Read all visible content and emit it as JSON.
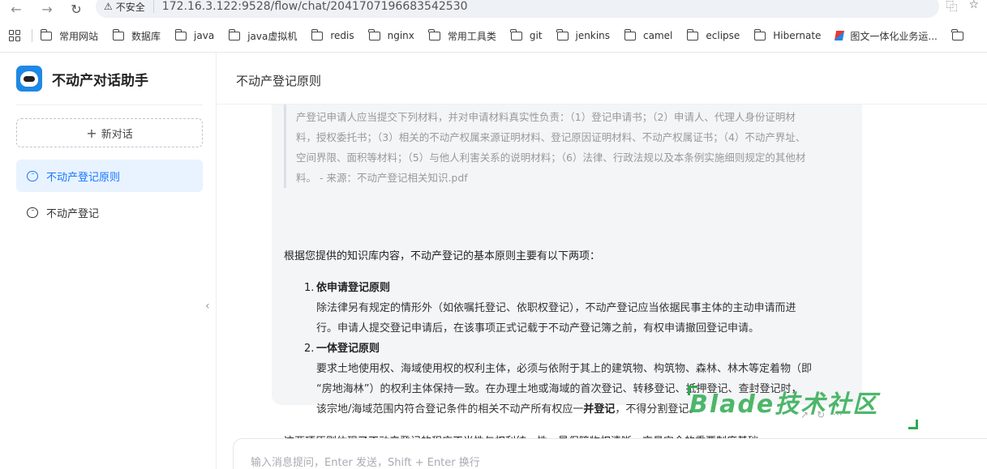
{
  "browser": {
    "insecure_label": "不安全",
    "url": "172.16.3.122:9528/flow/chat/2041707196683542530",
    "bookmarks": [
      "常用网站",
      "数据库",
      "java",
      "java虚拟机",
      "redis",
      "nginx",
      "常用工具类",
      "git",
      "jenkins",
      "camel",
      "eclipse",
      "Hibernate",
      "图文一体化业务运..."
    ]
  },
  "app": {
    "name": "不动产对话助手",
    "new_chat_label": "新对话",
    "conversations": [
      {
        "label": "不动产登记原则",
        "active": true
      },
      {
        "label": "不动产登记",
        "active": false
      }
    ]
  },
  "chat": {
    "title": "不动产登记原则",
    "quote_lines": [
      "产登记申请人应当提交下列材料，并对申请材料真实性负责：（1）登记申请书；（2）申请人、代理人身份证明材",
      "料，授权委托书；（3）相关的不动产权属来源证明材料、登记原因证明材料、不动产权属证书；（4）不动产界址、",
      "空间界限、面积等材料；（5）与他人利害关系的说明材料；（6）法律、行政法规以及本条例实施细则规定的其他材",
      "料。 - 来源：不动产登记相关知识.pdf"
    ],
    "intro": "根据您提供的知识库内容，不动产登记的基本原则主要有以下两项：",
    "principles": [
      {
        "num": "1.",
        "title": "依申请登记原则",
        "lines": [
          "除法律另有规定的情形外（如依嘱托登记、依职权登记），不动产登记应当依据民事主体的主动申请而进",
          "行。申请人提交登记申请后，在该事项正式记载于不动产登记簿之前，有权申请撤回登记申请。"
        ]
      },
      {
        "num": "2.",
        "title": "一体登记原则",
        "lines": [
          "要求土地使用权、海域使用权的权利主体，必须与依附于其上的建筑物、构筑物、森林、林木等定着物（即",
          "“房地海林”）的权利主体保持一致。在办理土地或海域的首次登记、转移登记、抵押登记、查封登记时，"
        ],
        "last_line_pre": "该宗地/海域范围内符合登记条件的相关不动产所有权应一",
        "last_line_bold": "并登记",
        "last_line_post": "，不得分割登记。"
      }
    ],
    "conclusion": "这两项原则体现了不动产登记的程序正当性与权利统一性，是保障物权清晰、交易安全的重要制度基础。",
    "input_placeholder": "输入消息提问，Enter 发送，Shift + Enter 换行"
  },
  "watermark": "Blade技术社区",
  "colors": {
    "accent": "#1677ff",
    "active_bg": "#e8f3ff",
    "watermark": "#2eaa50"
  }
}
